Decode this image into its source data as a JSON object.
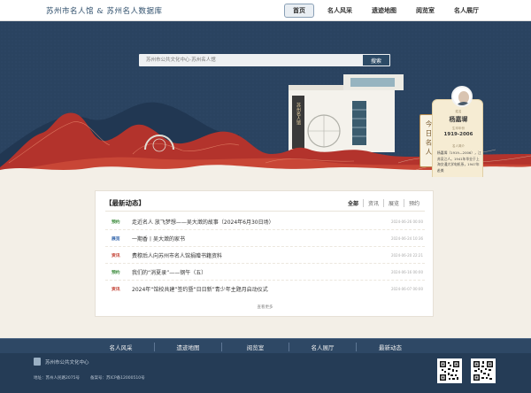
{
  "header": {
    "logo_text": "苏州市名人馆 & 苏州名人数据库",
    "nav": [
      {
        "label": "首页",
        "active": true
      },
      {
        "label": "名人风采",
        "active": false
      },
      {
        "label": "遗迹地图",
        "active": false
      },
      {
        "label": "阅览室",
        "active": false
      },
      {
        "label": "名人展厅",
        "active": false
      }
    ]
  },
  "hero": {
    "search_placeholder": "苏州市公共文化中心·苏州名人馆",
    "search_button": "搜索",
    "today_label": "今日名人",
    "figure": {
      "name_label": "姓名",
      "name": "杨嘉墀",
      "years_label": "生卒年份",
      "years": "1919-2006",
      "bio_label": "名人简介",
      "bio": "杨嘉墀（1919—2006），江苏吴江人。1941年毕业于上海交通大学电机系，1947年赴美"
    }
  },
  "news": {
    "title": "【最新动态】",
    "filters": [
      "全部",
      "资讯",
      "展览",
      "预约"
    ],
    "items": [
      {
        "tag": "预约",
        "tag_color": "#3a8a3a",
        "text": "走近名人 放飞梦想——吴大澂的故事（2024年6月30日场）",
        "date": "2024-06-26 00:00"
      },
      {
        "tag": "展览",
        "tag_color": "#2b5fa8",
        "text": "一期香丨吴大澂的家书",
        "date": "2024-06-24 10:36"
      },
      {
        "tag": "资讯",
        "tag_color": "#c0392b",
        "text": "费穆后人向苏州市名人馆捐赠书籍资料",
        "date": "2024-06-20 22:21"
      },
      {
        "tag": "预约",
        "tag_color": "#3a8a3a",
        "text": "我们的“消夏录”——钢午（五）",
        "date": "2024-06-16 00:00"
      },
      {
        "tag": "资讯",
        "tag_color": "#c0392b",
        "text": "2024年“馆校共建”签约暨“日日新”青少年主题月启动仪式",
        "date": "2024-06-07 00:00"
      }
    ],
    "more": "查看更多"
  },
  "footer": {
    "nav": [
      "名人风采",
      "遗迹地图",
      "阅览室",
      "名人展厅",
      "最新动态"
    ],
    "org_name": "苏州市公共文化中心",
    "address": "地址：苏州人民路2075号",
    "icp": "备案号：苏ICP备12000510号"
  }
}
